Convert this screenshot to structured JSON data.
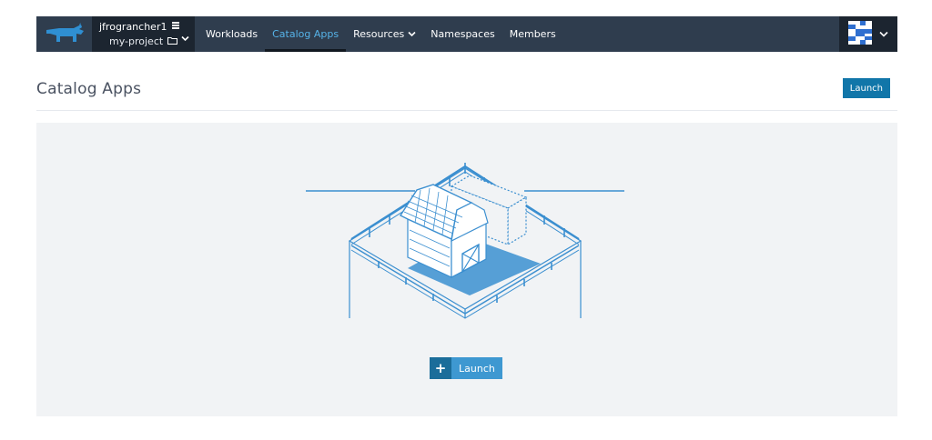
{
  "header": {
    "cluster": "jfrograncher1",
    "project": "my-project",
    "nav": [
      {
        "label": "Workloads"
      },
      {
        "label": "Catalog Apps"
      },
      {
        "label": "Resources"
      },
      {
        "label": "Namespaces"
      },
      {
        "label": "Members"
      }
    ],
    "active_nav": "Catalog Apps"
  },
  "page": {
    "title": "Catalog Apps",
    "launch_label": "Launch"
  },
  "empty_state": {
    "launch_label": "Launch",
    "plus_icon": "+"
  },
  "colors": {
    "navbar": "#2f3d4e",
    "context": "#1c2530",
    "active_nav": "#56b3e8",
    "primary": "#1176a9",
    "illustration": "#3b8fd0"
  }
}
